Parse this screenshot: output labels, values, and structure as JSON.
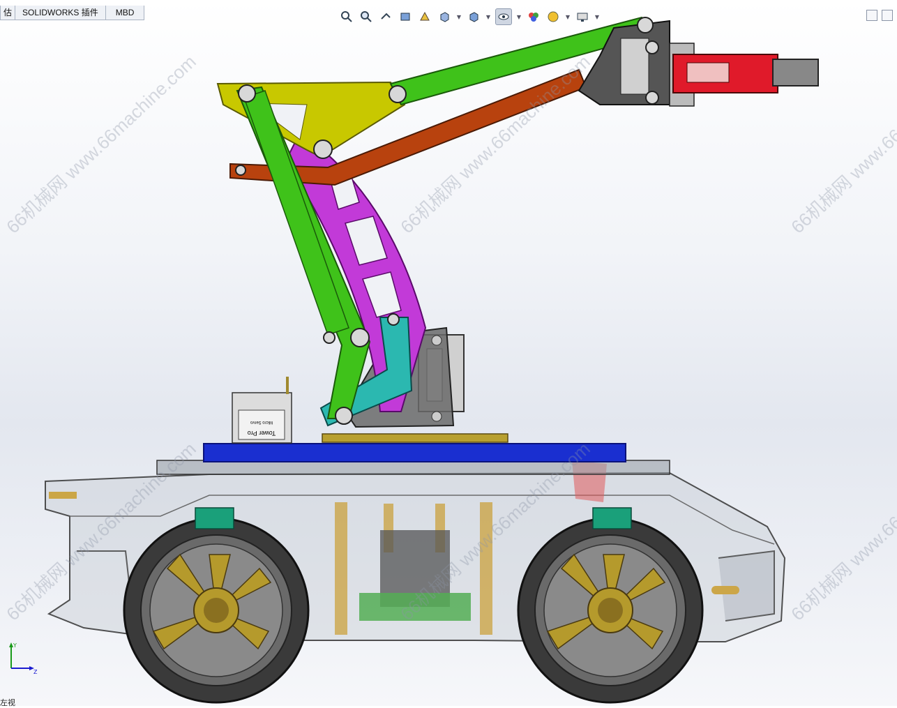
{
  "tabs": [
    {
      "label": "估"
    },
    {
      "label": "SOLIDWORKS 插件"
    },
    {
      "label": "MBD"
    }
  ],
  "hud_icons": [
    "zoom-to-fit-icon",
    "zoom-area-icon",
    "previous-view-icon",
    "section-view-icon",
    "dynamic-annotation-icon",
    "view-orientation-icon",
    "display-style-icon",
    "hide-show-items-icon",
    "edit-appearance-icon",
    "apply-scene-icon",
    "view-settings-icon"
  ],
  "servo_label": {
    "line1": "Tower Pro",
    "line2": "Micro Servo"
  },
  "watermark": {
    "text": "66机械网 www.66machine.com"
  },
  "triad": {
    "y": "Y",
    "z": "Z"
  },
  "view_label": "左视",
  "colors": {
    "arm_green": "#3fc21a",
    "arm_yellow": "#c8c800",
    "arm_magenta": "#c23ad8",
    "arm_orange": "#b8420e",
    "arm_cyan": "#2bb8b0",
    "base_blue": "#1a2fd0",
    "gripper_red": "#e01a2a",
    "wheel_gold": "#b59a2c"
  }
}
